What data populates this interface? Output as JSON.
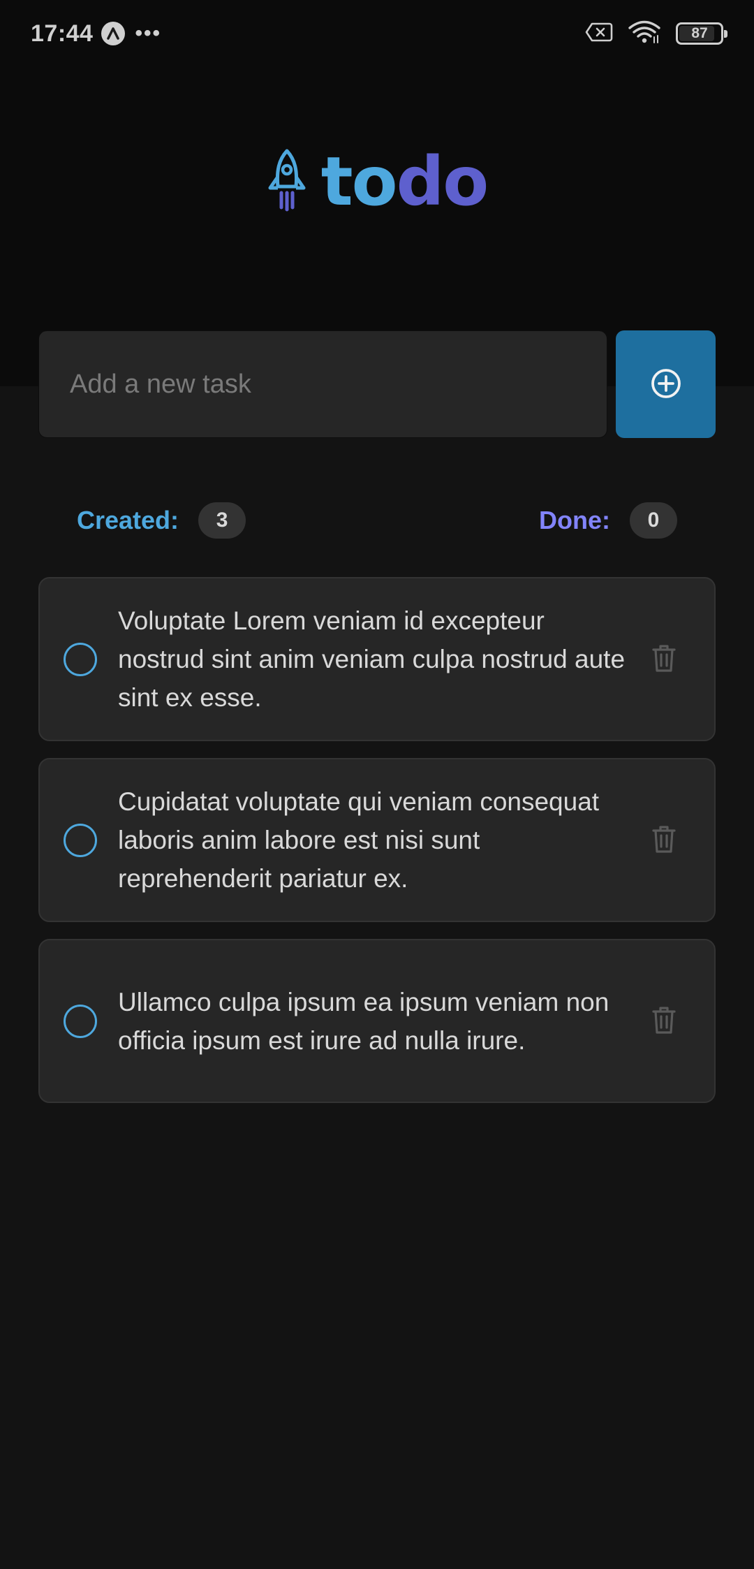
{
  "status_bar": {
    "time": "17:44",
    "more_dots": "•••",
    "battery_level": 87,
    "battery_text": "87",
    "icons": [
      "app-notification-icon",
      "battery-saver-x-icon",
      "wifi-icon",
      "battery-icon"
    ]
  },
  "logo": {
    "text_part1": "to",
    "text_part2": "do",
    "icon": "rocket-icon",
    "colors": {
      "blue": "#4ea8de",
      "purple": "#5e60ce"
    }
  },
  "new_task": {
    "value": "",
    "placeholder": "Add a new task",
    "add_icon": "plus-circle-icon",
    "button_color": "#1e6f9f"
  },
  "counters": {
    "created_label": "Created:",
    "created_count": "3",
    "done_label": "Done:",
    "done_count": "0"
  },
  "tasks": [
    {
      "text": "Voluptate Lorem veniam id excepteur nostrud sint anim veniam culpa nostrud aute sint ex esse.",
      "done": false
    },
    {
      "text": "Cupidatat voluptate qui veniam consequat laboris anim labore est nisi sunt reprehenderit pariatur ex.",
      "done": false
    },
    {
      "text": "Ullamco culpa ipsum ea ipsum veniam non officia ipsum est irure ad nulla irure.",
      "done": false
    }
  ]
}
